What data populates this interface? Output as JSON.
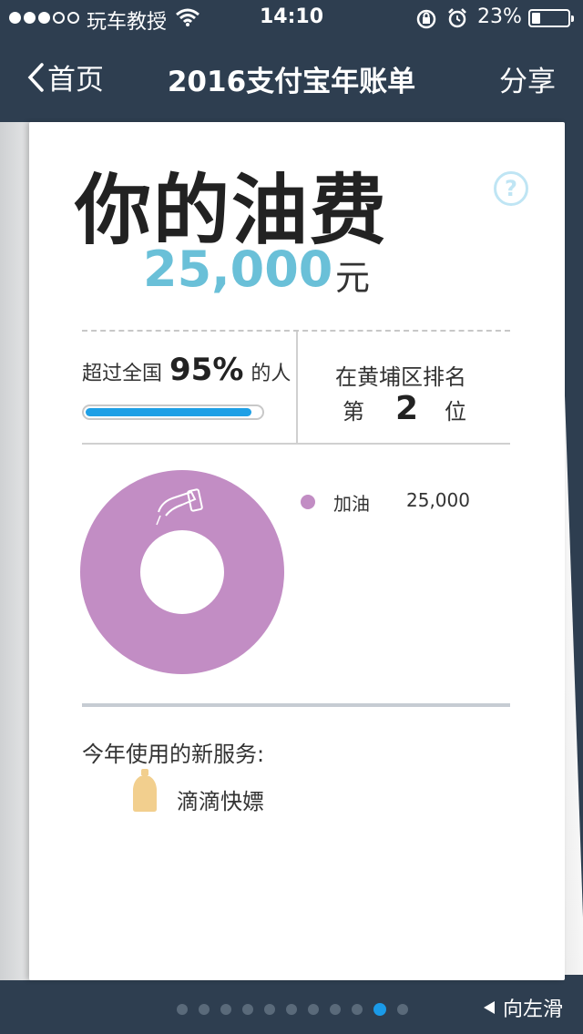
{
  "status_bar": {
    "carrier": "玩车教授",
    "time": "14:10",
    "battery": "23%",
    "battery_level": 0.23
  },
  "nav": {
    "back_label": "首页",
    "title": "2016支付宝年账单",
    "share_label": "分享"
  },
  "card": {
    "headline": "你的油费",
    "help_symbol": "?",
    "amount": "25,000",
    "unit": "元",
    "exceed_prefix": "超过全国",
    "exceed_percent": "95%",
    "exceed_suffix": "的人",
    "exceed_fraction": 0.95,
    "rank_label": "在黄埔区排名",
    "rank_prefix": "第",
    "rank_value": "2",
    "rank_suffix": "位",
    "breakdown": [
      {
        "label": "加油",
        "value": "25,000",
        "color": "#c28dc4",
        "icon": "fuel-nozzle-icon"
      }
    ],
    "services_title": "今年使用的新服务:",
    "services": [
      {
        "name": "滴滴快嫖",
        "icon": "bottle-icon",
        "color": "#f2cf8e"
      }
    ]
  },
  "pager": {
    "count": 11,
    "active_index": 9
  },
  "swipe_hint": "向左滑",
  "colors": {
    "background": "#2e3e50",
    "accent": "#6ac0d8",
    "progress": "#1ea0e6",
    "donut": "#c28dc4"
  }
}
